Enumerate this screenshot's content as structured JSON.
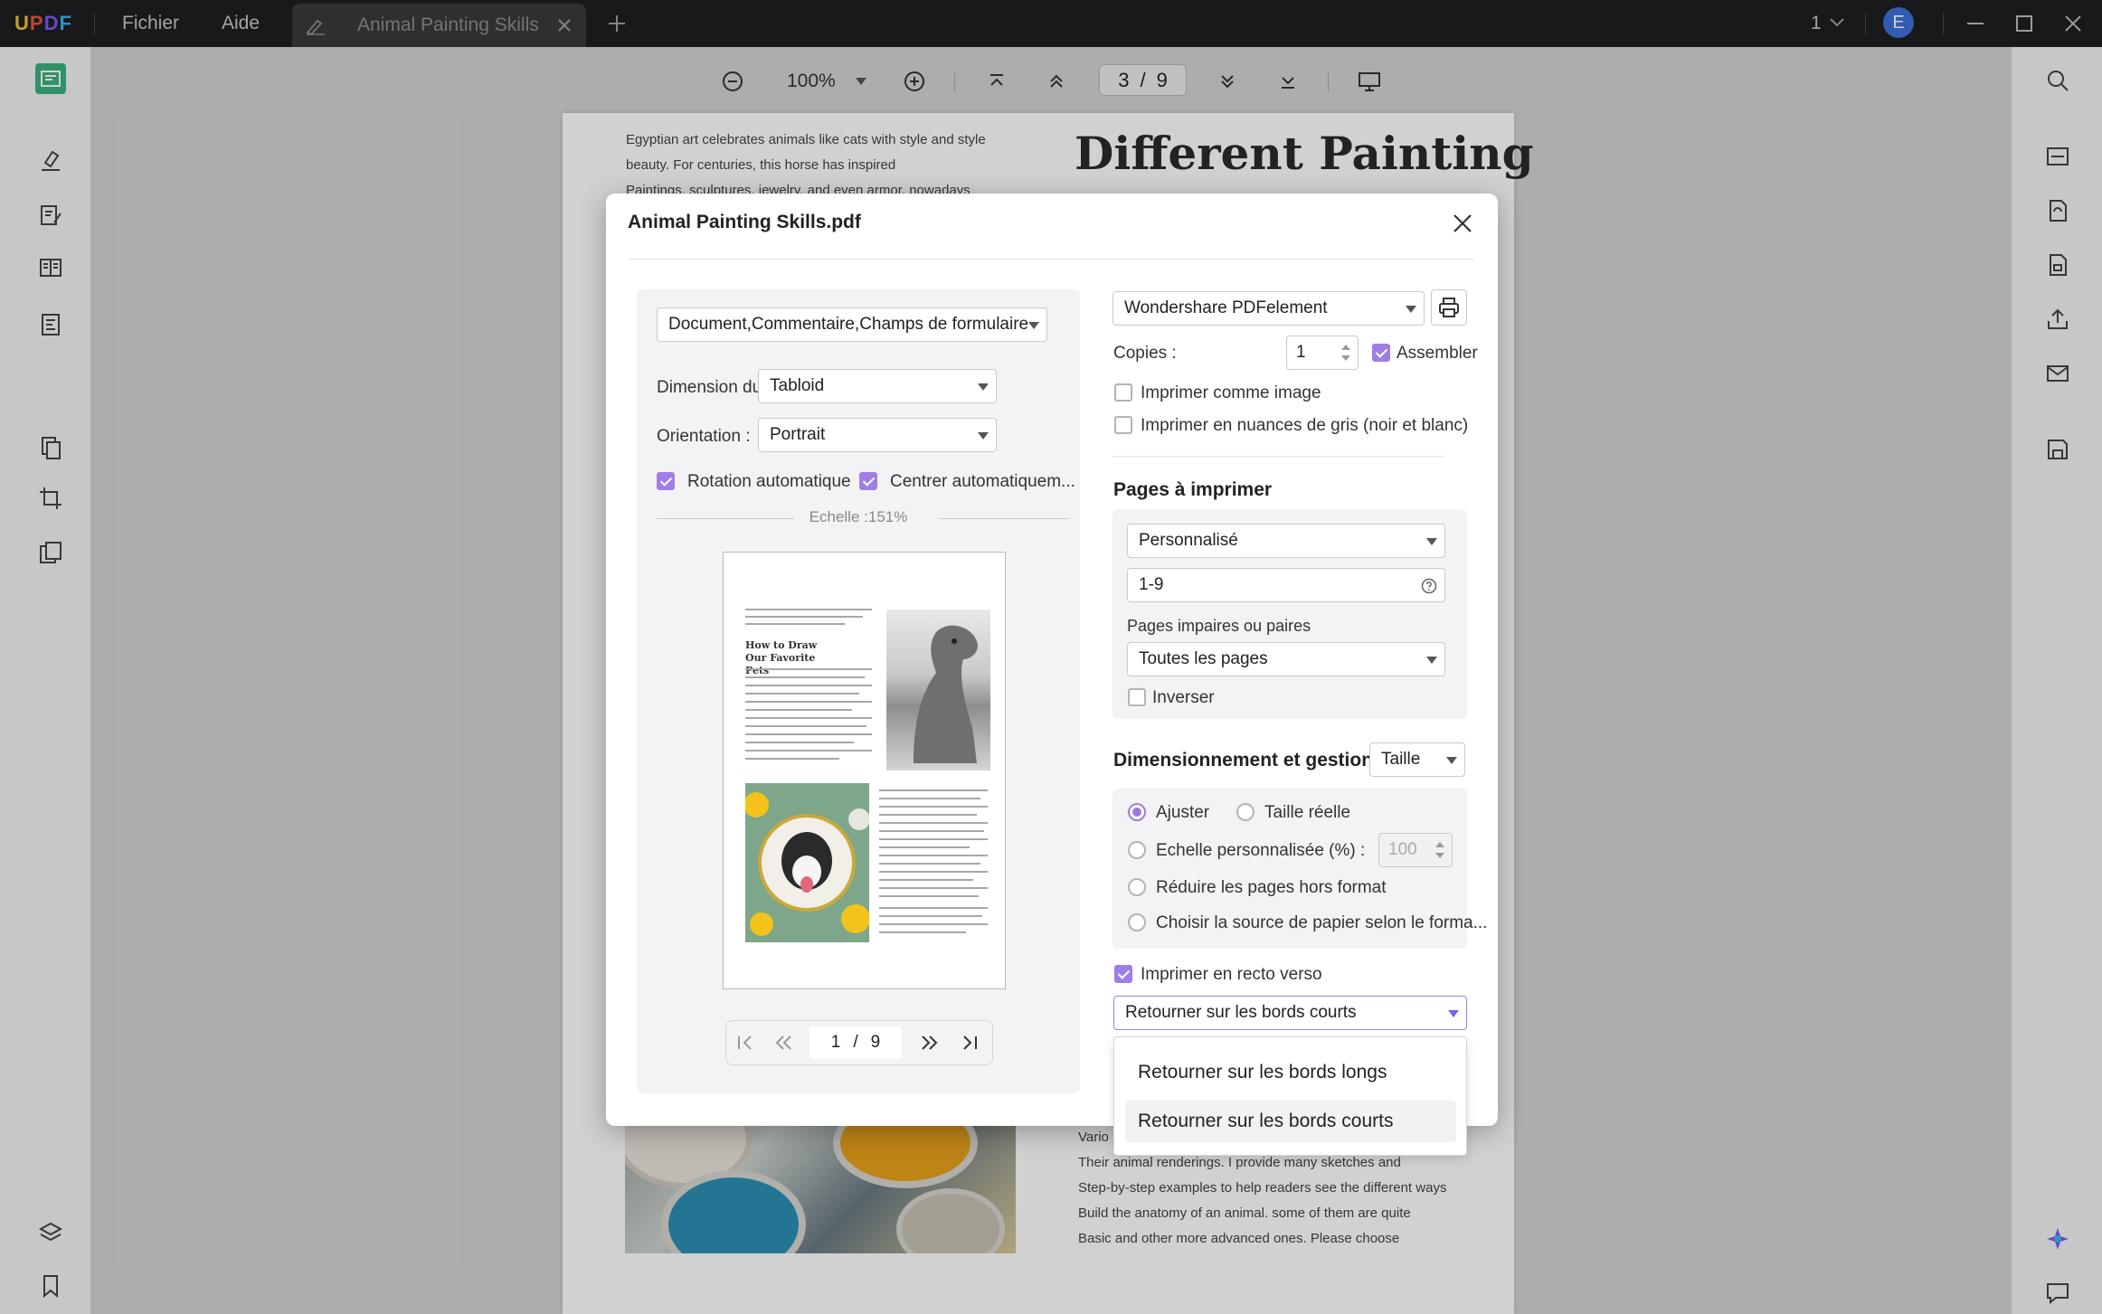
{
  "app": {
    "logo": "UPDF",
    "menu": [
      "Fichier",
      "Aide"
    ],
    "tab_title": "Animal Painting Skills",
    "window_count": "1",
    "user_initial": "E"
  },
  "toolbar": {
    "zoom": "100%",
    "current_page": "3",
    "page_sep": "/",
    "total_pages": "9"
  },
  "document": {
    "body_lines_top": [
      "Egyptian art celebrates animals like cats with style and style",
      "beauty. For centuries, this horse has inspired",
      "Paintings, sculptures, jewelry, and even armor, nowadays"
    ],
    "heading": "Different Painting",
    "body_lines_bottom": [
      "Vario",
      "Their animal renderings. I provide many sketches and",
      "Step-by-step examples to help readers see the different ways",
      "Build the anatomy of an animal. some of them are quite",
      "Basic and other more advanced ones. Please choose"
    ]
  },
  "dialog": {
    "title": "Animal Painting Skills.pdf",
    "content_select": "Document,Commentaire,Champs de formulaire",
    "paper_size_label": "Dimension du papi...",
    "paper_size_value": "Tabloid",
    "orientation_label": "Orientation :",
    "orientation_value": "Portrait",
    "auto_rotate_label": "Rotation automatique",
    "auto_center_label": "Centrer automatiquem...",
    "scale_label": "Echelle :151%",
    "preview": {
      "heading": "How to Draw Our Favorite Pets",
      "current": "1",
      "sep": "/",
      "total": "9"
    },
    "printer_value": "Wondershare PDFelement",
    "copies_label": "Copies :",
    "copies_value": "1",
    "collate_label": "Assembler",
    "print_as_image_label": "Imprimer comme image",
    "grayscale_label": "Imprimer en nuances de gris (noir et blanc)",
    "pages_section_title": "Pages à imprimer",
    "pages_mode_value": "Personnalisé",
    "pages_range_value": "1-9",
    "odd_even_label": "Pages impaires ou paires",
    "odd_even_value": "Toutes les pages",
    "reverse_label": "Inverser",
    "sizing_section_title": "Dimensionnement et gestion.",
    "sizing_mode_value": "Taille",
    "fit_label": "Ajuster",
    "actual_size_label": "Taille réelle",
    "custom_scale_label": "Echelle personnalisée (%) :",
    "custom_scale_value": "100",
    "shrink_label": "Réduire les pages hors format",
    "paper_source_label": "Choisir la source de papier selon le forma...",
    "duplex_label": "Imprimer en recto verso",
    "duplex_value": "Retourner sur les bords courts",
    "duplex_options": [
      "Retourner sur les bords longs",
      "Retourner sur les bords courts"
    ]
  },
  "colors": {
    "accent": "#a07ee8",
    "titlebar": "#1f1f21",
    "sidebar": "#f3f3f5"
  },
  "icons": {
    "left_sidebar": [
      "reader-icon",
      "highlighter-icon",
      "edit-text-icon",
      "organize-pages-icon",
      "form-icon",
      "convert-icon",
      "crop-icon",
      "compare-icon",
      "layers-icon",
      "bookmark-icon",
      "attachment-icon"
    ],
    "right_sidebar": [
      "search-icon",
      "ocr-icon",
      "convert-file-icon",
      "protect-icon",
      "share-icon",
      "email-icon",
      "save-icon",
      "ai-assistant-icon",
      "comment-icon"
    ]
  }
}
